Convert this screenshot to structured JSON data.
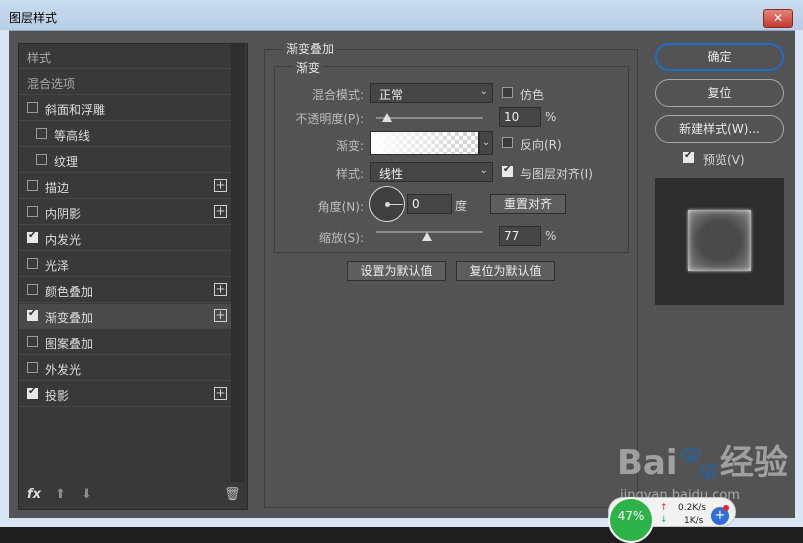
{
  "window": {
    "title": "图层样式",
    "close_label": "✕"
  },
  "styles_list": {
    "header": "样式",
    "blend_options": "混合选项",
    "items": [
      {
        "label": "斜面和浮雕",
        "checked": false,
        "has_plus": false
      },
      {
        "label": "等高线",
        "checked": false,
        "has_plus": false,
        "indent": true
      },
      {
        "label": "纹理",
        "checked": false,
        "has_plus": false,
        "indent": true
      },
      {
        "label": "描边",
        "checked": false,
        "has_plus": true
      },
      {
        "label": "内阴影",
        "checked": false,
        "has_plus": true
      },
      {
        "label": "内发光",
        "checked": true,
        "has_plus": false
      },
      {
        "label": "光泽",
        "checked": false,
        "has_plus": false
      },
      {
        "label": "颜色叠加",
        "checked": false,
        "has_plus": true
      },
      {
        "label": "渐变叠加",
        "checked": true,
        "has_plus": true,
        "selected": true
      },
      {
        "label": "图案叠加",
        "checked": false,
        "has_plus": false
      },
      {
        "label": "外发光",
        "checked": false,
        "has_plus": false
      },
      {
        "label": "投影",
        "checked": true,
        "has_plus": true
      }
    ],
    "plus_glyph": "+",
    "fx_label": "fx",
    "up_glyph": "⬆",
    "down_glyph": "⬇",
    "trash_glyph": "🗑"
  },
  "gradient_overlay": {
    "section_title": "渐变叠加",
    "group_title": "渐变",
    "blend_mode_label": "混合模式:",
    "blend_mode_value": "正常",
    "dither_label": "仿色",
    "dither_checked": false,
    "opacity_label": "不透明度(P):",
    "opacity_value": "10",
    "opacity_percent": 10,
    "percent_unit": "%",
    "gradient_label": "渐变:",
    "reverse_label": "反向(R)",
    "reverse_checked": false,
    "style_label": "样式:",
    "style_value": "线性",
    "align_label": "与图层对齐(I)",
    "align_checked": true,
    "angle_label": "角度(N):",
    "angle_value": "0",
    "degree_unit": "度",
    "reset_align_label": "重置对齐",
    "scale_label": "缩放(S):",
    "scale_value": "77",
    "scale_percent": 77,
    "set_default_label": "设置为默认值",
    "reset_default_label": "复位为默认值",
    "dropdown_arrow": "⌄"
  },
  "actions": {
    "ok_label": "确定",
    "reset_label": "复位",
    "new_style_label": "新建样式(W)...",
    "preview_label": "预览(V)",
    "preview_checked": true
  },
  "watermark": {
    "text": "Bai🐾经验",
    "url": "jingyan.baidu.com"
  },
  "net_widget": {
    "percent": "47%",
    "up": "0.2K/s",
    "down": "1K/s",
    "plus": "+"
  }
}
